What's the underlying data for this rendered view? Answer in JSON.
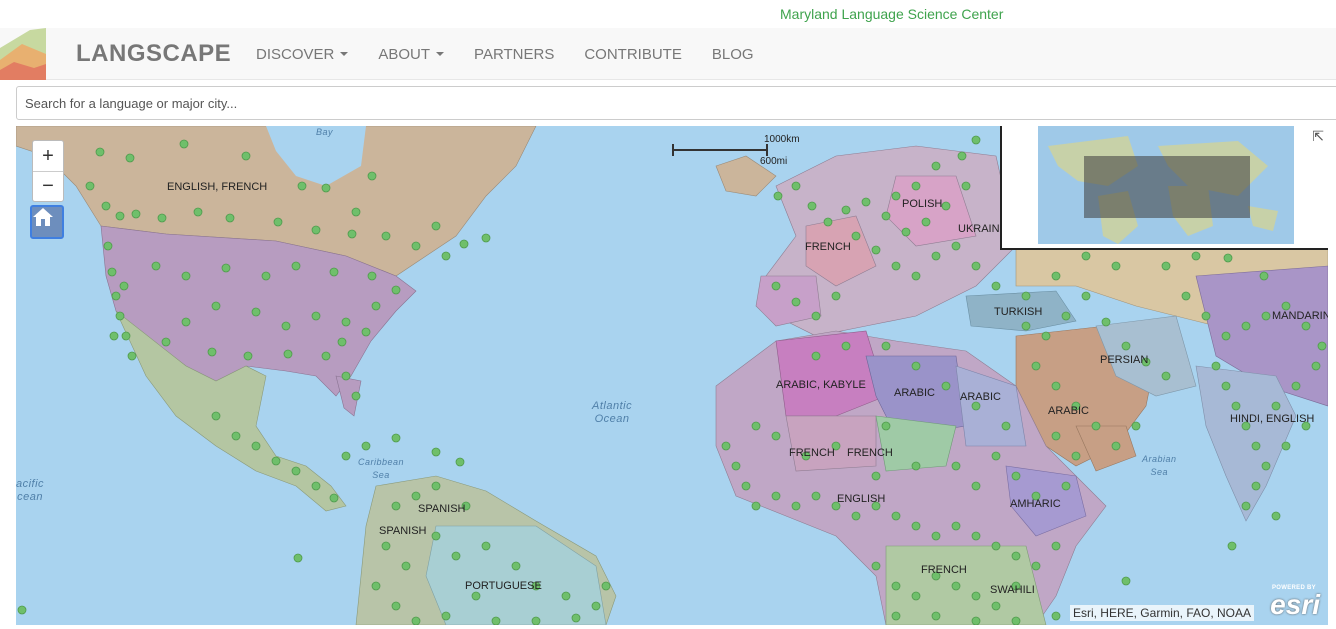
{
  "header": {
    "org": "Maryland Language Science Center"
  },
  "nav": {
    "brand": "LANGSCAPE",
    "items": [
      {
        "label": "DISCOVER",
        "dropdown": true
      },
      {
        "label": "ABOUT",
        "dropdown": true
      },
      {
        "label": "PARTNERS",
        "dropdown": false
      },
      {
        "label": "CONTRIBUTE",
        "dropdown": false
      },
      {
        "label": "BLOG",
        "dropdown": false
      }
    ]
  },
  "search": {
    "placeholder": "Search for a language or major city..."
  },
  "map": {
    "zoom_in": "+",
    "zoom_out": "−",
    "scale": {
      "km": "1000km",
      "mi": "600mi"
    },
    "attribution": "Esri, HERE, Garmin, FAO, NOAA",
    "esri_powered": "POWERED BY",
    "esri_word": "esri",
    "overview_toggle": "⇱",
    "language_labels": [
      "ENGLISH, FRENCH",
      "POLISH",
      "UKRAIN",
      "FRENCH",
      "TURKISH",
      "MANDARIN",
      "ARABIC, KABYLE",
      "ARABIC",
      "ARABIC",
      "ARABIC",
      "PERSIAN",
      "HINDI, ENGLISH",
      "FRENCH",
      "FRENCH",
      "ENGLISH",
      "AMHARIC",
      "SPANISH",
      "SPANISH",
      "PORTUGUESE",
      "FRENCH",
      "SWAHILI"
    ],
    "ocean_labels": {
      "bay": "Bay",
      "atlantic": "Atlantic",
      "atlantic2": "Ocean",
      "caribbean": "Caribbean",
      "caribbean2": "Sea",
      "arabian": "Arabian",
      "arabian2": "Sea",
      "pacific": "acific",
      "pacific2": "cean"
    },
    "colors": {
      "land_na": "#cbb59b",
      "land_us": "#b79cc0",
      "water": "#a9d3ef",
      "marker": "#6fbf6b"
    }
  }
}
